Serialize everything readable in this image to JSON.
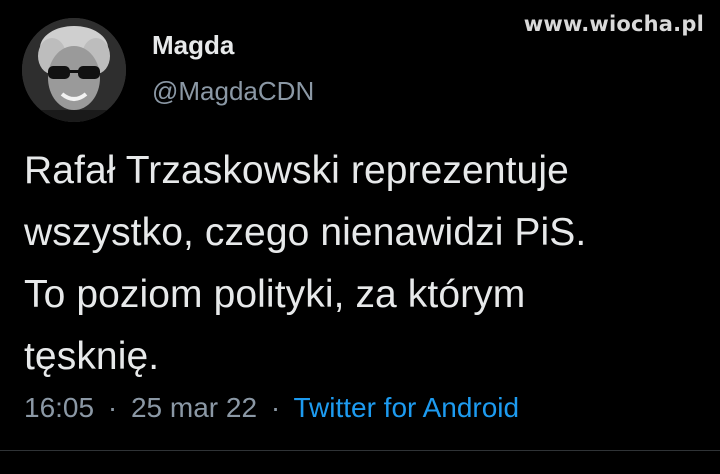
{
  "watermark": "www.wiocha.pl",
  "author": {
    "name": "Magda",
    "handle": "@MagdaCDN",
    "avatar_icon": "profile-photo"
  },
  "tweet": {
    "lines": [
      "Rafał Trzaskowski reprezentuje",
      "wszystko, czego nienawidzi PiS.",
      "To poziom polityki, za którym",
      "tęsknię."
    ]
  },
  "meta": {
    "time": "16:05",
    "separator": "·",
    "date": "25 mar 22",
    "source": "Twitter for Android"
  },
  "colors": {
    "background": "#000000",
    "text": "#e7e9ea",
    "secondary": "#8b98a5",
    "accent": "#1d9bf0"
  }
}
